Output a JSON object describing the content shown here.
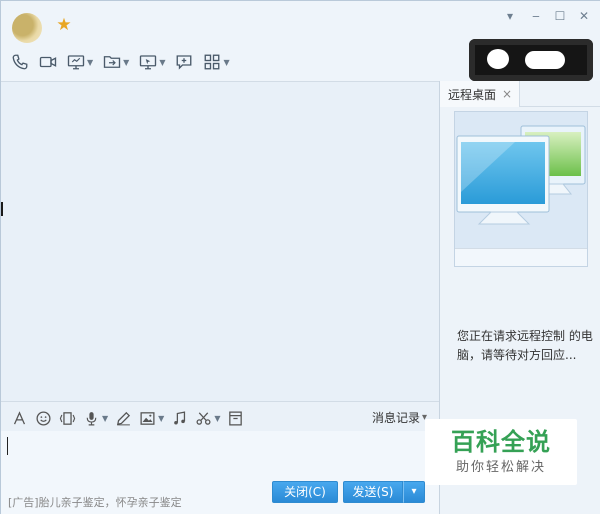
{
  "window": {
    "controls": {
      "menu": "▾",
      "minimize": "‒",
      "maximize": "☐",
      "close": "✕"
    }
  },
  "toolbar": {
    "items": [
      {
        "icon": "phone-icon"
      },
      {
        "icon": "video-icon"
      },
      {
        "icon": "screen-share-icon",
        "dropdown": true
      },
      {
        "icon": "file-transfer-icon",
        "dropdown": true
      },
      {
        "icon": "remote-desktop-icon",
        "dropdown": true
      },
      {
        "icon": "add-app-icon"
      },
      {
        "icon": "apps-grid-icon",
        "dropdown": true
      }
    ]
  },
  "right_panel": {
    "tab_label": "远程桌面",
    "tab_close": "×",
    "status_text": "您正在请求远程控制 的电脑，请等待对方回应..."
  },
  "input_toolbar": {
    "history_label": "消息记录",
    "history_caret": "▾"
  },
  "input": {
    "ad_text": "[广告]胎儿亲子鉴定，怀孕亲子鉴定"
  },
  "buttons": {
    "close_label": "关闭(C)",
    "send_label": "发送(S)",
    "send_dropdown": "▾"
  },
  "watermark": {
    "title": "百科全说",
    "subtitle": "助你轻松解决"
  },
  "colors": {
    "accent": "#2a8ad6",
    "watermark_green": "#35a155",
    "star": "#e8a623"
  }
}
